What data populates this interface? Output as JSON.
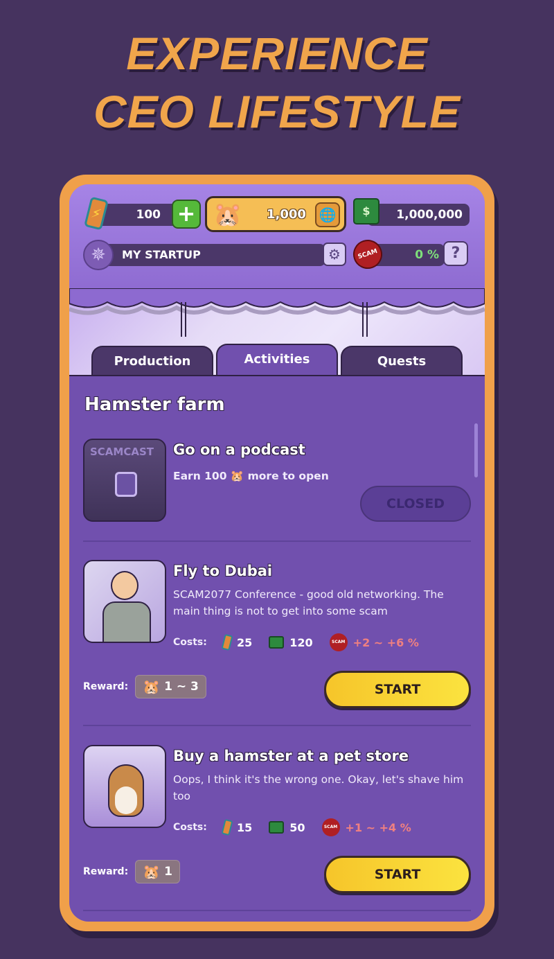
{
  "headline": {
    "line1": "EXPERIENCE",
    "line2": "CEO LIFESTYLE"
  },
  "colors": {
    "background": "#46335f",
    "frame": "#f0a04a",
    "panel": "#7150ae",
    "start": "#f6c52a",
    "scam": "#b01f23"
  },
  "hud": {
    "energy": {
      "icon": "energy-can-icon",
      "value": "100",
      "add_label": "+"
    },
    "coins": {
      "icon": "hamster-face-icon",
      "value": "1,000",
      "globe_icon": "globe-icon"
    },
    "cash": {
      "icon": "cash-stack-icon",
      "value": "1,000,000"
    },
    "startup": {
      "icon": "star-badge-icon",
      "label": "MY STARTUP",
      "settings_icon": "gear-icon"
    },
    "scam": {
      "icon": "scam-seal-icon",
      "seal_text": "SCAM",
      "value": "0 %",
      "help_label": "?"
    }
  },
  "tabs": [
    {
      "label": "Production",
      "active": false
    },
    {
      "label": "Activities",
      "active": true
    },
    {
      "label": "Quests",
      "active": false
    }
  ],
  "section_title": "Hamster farm",
  "activities": [
    {
      "title": "Go on a podcast",
      "thumbnail": "scamcast-podcast-locked",
      "thumb_text": "SCAMCAST",
      "lock_note": {
        "prefix": "Earn",
        "amount": "100",
        "suffix": "more to open"
      },
      "button_label": "CLOSED",
      "state": "closed"
    },
    {
      "title": "Fly to Dubai",
      "thumbnail": "man-on-airplane",
      "description": "SCAM2077 Conference - good old networking. The main thing is not to get into some scam",
      "costs_label": "Costs:",
      "costs": {
        "energy": "25",
        "cash": "120",
        "scam": "+2 ~ +6 %"
      },
      "reward_label": "Reward:",
      "reward": "1 ~ 3",
      "button_label": "START",
      "state": "available"
    },
    {
      "title": "Buy a hamster at a pet store",
      "thumbnail": "hamster-in-pet-store",
      "description": "Oops, I think it's the wrong one. Okay, let's shave him too",
      "costs_label": "Costs:",
      "costs": {
        "energy": "15",
        "cash": "50",
        "scam": "+1 ~ +4 %"
      },
      "reward_label": "Reward:",
      "reward": "1",
      "button_label": "START",
      "state": "available"
    }
  ]
}
